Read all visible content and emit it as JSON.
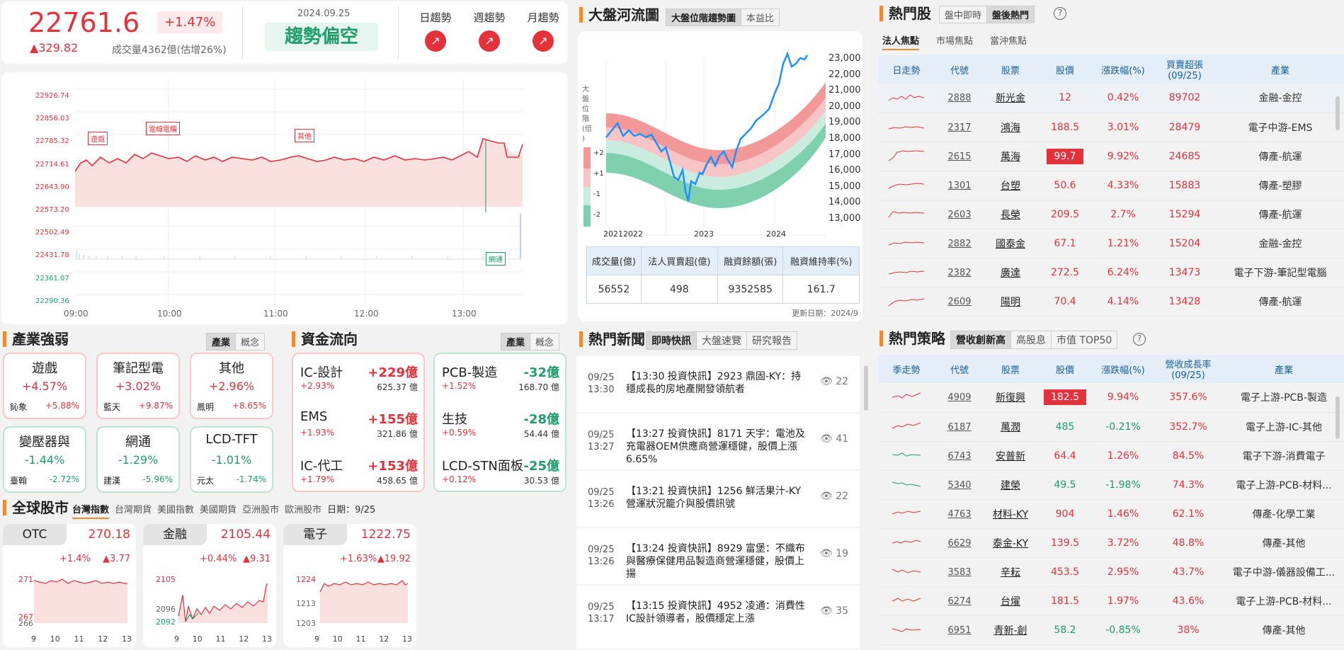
{
  "header": {
    "index": "22761.6",
    "change": "▲329.82",
    "pct": "+1.47%",
    "date": "2024.09.25",
    "volume": "成交量4362億(估增26%)",
    "trend": "趨勢偏空",
    "trends": [
      "日趨勢",
      "週趨勢",
      "月趨勢"
    ]
  },
  "intraday": {
    "y_ticks": [
      "22926.74",
      "22856.03",
      "22785.32",
      "22714.61",
      "22643.90",
      "22573.20",
      "22502.49",
      "22431.78",
      "22361.07",
      "22290.36"
    ],
    "x_ticks": [
      "09:00",
      "10:00",
      "11:00",
      "12:00",
      "13:00"
    ],
    "tags": [
      "遊戲",
      "電線電纜",
      "其他",
      "網通"
    ]
  },
  "river": {
    "title": "大盤河流圖",
    "tabs": [
      "大盤位階趨勢圖",
      "本益比"
    ],
    "ylabel": "大盤位階(倍)",
    "levels": [
      "+2",
      "+1",
      "-1",
      "-2"
    ],
    "y_ticks": [
      "23,000",
      "22,000",
      "21,000",
      "20,000",
      "19,000",
      "18,000",
      "17,000",
      "16,000",
      "15,000",
      "14,000",
      "13,000"
    ],
    "x_ticks": [
      "2021",
      "2022",
      "2023",
      "2024"
    ],
    "stats_headers": [
      "成交量(億)",
      "法人買賣超(億)",
      "融資餘額(張)",
      "融資維持率(%)"
    ],
    "stats_values": [
      "56552",
      "498",
      "9352585",
      "161.7"
    ],
    "updated": "更新日期：2024/9"
  },
  "hot": {
    "title": "熱門股",
    "tabs": [
      "盤中即時",
      "盤後熱門"
    ],
    "subtabs": [
      "法人焦點",
      "市場焦點",
      "當沖焦點"
    ],
    "headers": [
      "日走勢",
      "代號",
      "股票",
      "股價",
      "漲跌幅(%)",
      "買賣超張(09/25)",
      "產業"
    ],
    "rows": [
      [
        "2888",
        "新光金",
        "12",
        "0.42%",
        "89702",
        "金融-金控"
      ],
      [
        "2317",
        "鴻海",
        "188.5",
        "3.01%",
        "28479",
        "電子中游-EMS"
      ],
      [
        "2615",
        "萬海",
        "99.7",
        "9.92%",
        "24685",
        "傳產-航運"
      ],
      [
        "1301",
        "台塑",
        "50.6",
        "4.33%",
        "15883",
        "傳產-塑膠"
      ],
      [
        "2603",
        "長榮",
        "209.5",
        "2.7%",
        "15294",
        "傳產-航運"
      ],
      [
        "2882",
        "國泰金",
        "67.1",
        "1.21%",
        "15204",
        "金融-金控"
      ],
      [
        "2382",
        "廣達",
        "272.5",
        "6.24%",
        "13473",
        "電子下游-筆記型電腦"
      ],
      [
        "2609",
        "陽明",
        "70.4",
        "4.14%",
        "13428",
        "傳產-航運"
      ]
    ]
  },
  "industry": {
    "title": "產業強弱",
    "tabs": [
      "產業",
      "概念"
    ],
    "items": [
      {
        "name": "遊戲",
        "pct": "+4.57%",
        "stock": "鈊象",
        "spct": "+5.88%"
      },
      {
        "name": "筆記型電",
        "pct": "+3.02%",
        "stock": "藍天",
        "spct": "+9.87%"
      },
      {
        "name": "其他",
        "pct": "+2.96%",
        "stock": "鳳明",
        "spct": "+8.65%"
      },
      {
        "name": "變壓器與",
        "pct": "-1.44%",
        "stock": "臺翰",
        "spct": "-2.72%"
      },
      {
        "name": "網通",
        "pct": "-1.29%",
        "stock": "建漢",
        "spct": "-5.96%"
      },
      {
        "name": "LCD-TFT",
        "pct": "-1.01%",
        "stock": "元太",
        "spct": "-1.74%"
      }
    ]
  },
  "funds": {
    "title": "資金流向",
    "tabs": [
      "產業",
      "概念"
    ],
    "in": [
      {
        "name": "IC-設計",
        "val": "+229億",
        "pct": "+2.93%",
        "amt": "625.37 億"
      },
      {
        "name": "EMS",
        "val": "+155億",
        "pct": "+1.93%",
        "amt": "321.86 億"
      },
      {
        "name": "IC-代工",
        "val": "+153億",
        "pct": "+1.79%",
        "amt": "458.65 億"
      }
    ],
    "out": [
      {
        "name": "PCB-製造",
        "val": "-32億",
        "pct": "+1.52%",
        "amt": "168.70 億"
      },
      {
        "name": "生技",
        "val": "-28億",
        "pct": "+0.59%",
        "amt": "54.44 億"
      },
      {
        "name": "LCD-STN面板",
        "val": "-25億",
        "pct": "+0.12%",
        "amt": "30.53 億"
      }
    ]
  },
  "news": {
    "title": "熱門新聞",
    "tabs": [
      "即時快訊",
      "大盤速覽",
      "研究報告"
    ],
    "items": [
      {
        "date": "09/25",
        "time": "13:30",
        "text": "【13:30 投資快訊】2923 鼎固-KY：持穩成長的房地產開發領航者",
        "views": "22"
      },
      {
        "date": "09/25",
        "time": "13:27",
        "text": "【13:27 投資快訊】8171 天宇：電池及充電器OEM供應商營運穩健，股價上漲6.65%",
        "views": "41"
      },
      {
        "date": "09/25",
        "time": "13:26",
        "text": "【13:21 投資快訊】1256 鮮活果汁-KY 營運狀況籠介與股價訊號",
        "views": "22"
      },
      {
        "date": "09/25",
        "time": "13:26",
        "text": "【13:24 投資快訊】8929 富堡：不織布與醫療保健用品製造商營運穩健，股價上揚",
        "views": "19"
      },
      {
        "date": "09/25",
        "time": "13:17",
        "text": "【13:15 投資快訊】4952 凌通：消費性IC設計領導者，股價穩定上漲",
        "views": "35"
      }
    ]
  },
  "strategy": {
    "title": "熱門策略",
    "tabs": [
      "營收創新高",
      "高股息",
      "市值 TOP50"
    ],
    "headers": [
      "季走勢",
      "代號",
      "股票",
      "股價",
      "漲跌幅(%)",
      "營收成長率(09/25)",
      "產業"
    ],
    "rows": [
      [
        "4909",
        "新復興",
        "182.5",
        "9.94%",
        "357.6%",
        "電子上游-PCB-製造"
      ],
      [
        "6187",
        "萬潤",
        "485",
        "-0.21%",
        "352.7%",
        "電子上游-IC-其他"
      ],
      [
        "6743",
        "安普新",
        "64.4",
        "1.26%",
        "84.5%",
        "電子下游-消費電子"
      ],
      [
        "5340",
        "建榮",
        "49.5",
        "-1.98%",
        "74.3%",
        "電子上游-PCB-材料..."
      ],
      [
        "4763",
        "材料-KY",
        "904",
        "1.46%",
        "62.1%",
        "傳產-化學工業"
      ],
      [
        "6629",
        "泰金-KY",
        "139.5",
        "3.72%",
        "48.8%",
        "傳產-其他"
      ],
      [
        "3583",
        "辛耘",
        "453.5",
        "2.95%",
        "43.7%",
        "電子中游-儀器設備工..."
      ],
      [
        "6274",
        "台燿",
        "181.5",
        "1.97%",
        "43.6%",
        "電子上游-PCB-材料..."
      ],
      [
        "6951",
        "青新-創",
        "58.2",
        "-0.85%",
        "38%",
        "傳產-其他"
      ]
    ]
  },
  "global": {
    "title": "全球股市",
    "tabs": [
      "台灣指數",
      "台灣期貨",
      "美國指數",
      "美國期貨",
      "亞洲股市",
      "歐洲股市"
    ],
    "date": "日期：9/25",
    "cards": [
      {
        "name": "OTC",
        "price": "270.18",
        "pct": "+1.4%",
        "chg": "▲3.77",
        "y": [
          "271",
          "267",
          "266"
        ],
        "x": [
          "9",
          "10",
          "11",
          "12",
          "13"
        ]
      },
      {
        "name": "金融",
        "price": "2105.44",
        "pct": "+0.44%",
        "chg": "▲9.31",
        "y": [
          "2105",
          "2096",
          "2092"
        ],
        "x": [
          "9",
          "10",
          "11",
          "12",
          "13"
        ]
      },
      {
        "name": "電子",
        "price": "1222.75",
        "pct": "+1.63%",
        "chg": "▲19.92",
        "y": [
          "1224",
          "1213",
          "1203"
        ],
        "x": [
          "9",
          "10",
          "11",
          "12",
          "13"
        ]
      }
    ]
  },
  "colors": {
    "up": "#e4323c",
    "down": "#1f9d6a",
    "accent": "#f08a2c"
  }
}
